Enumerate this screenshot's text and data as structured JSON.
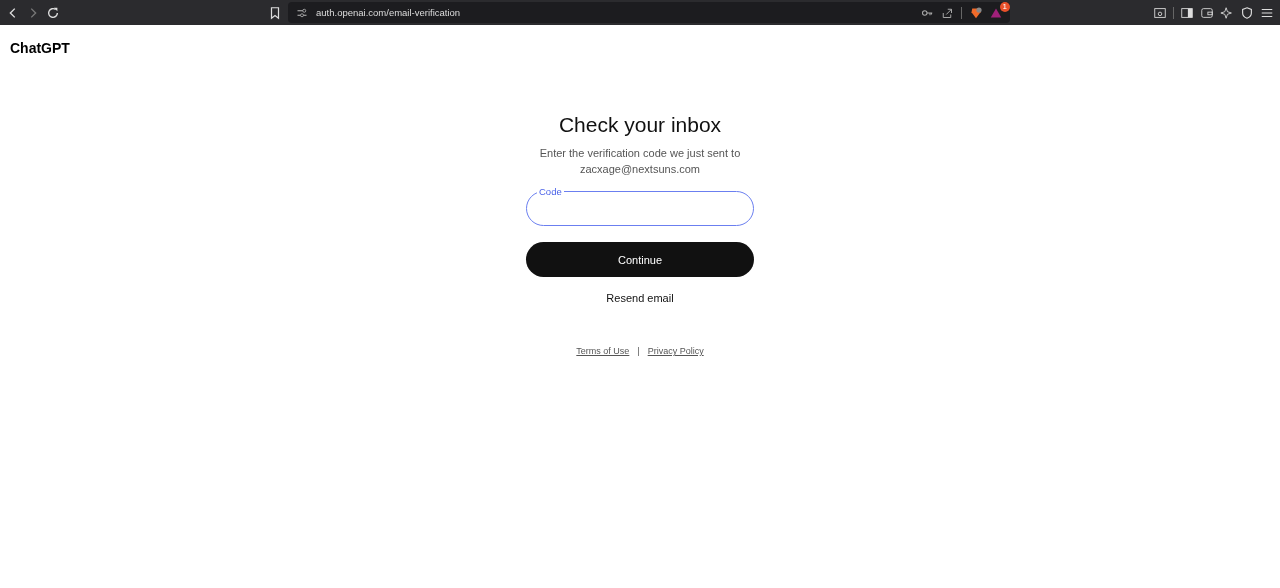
{
  "browser": {
    "url": "auth.openai.com/email-verification",
    "notification_badge": "1"
  },
  "brand": "ChatGPT",
  "title": "Check your inbox",
  "subtitle": "Enter the verification code we just sent to",
  "email": "zacxage@nextsuns.com",
  "code_field": {
    "label": "Code",
    "focused": true
  },
  "continue_button": "Continue",
  "resend_link": "Resend email",
  "footer": {
    "links": [
      "Terms of Use",
      "Privacy Policy"
    ],
    "separator": "|"
  }
}
